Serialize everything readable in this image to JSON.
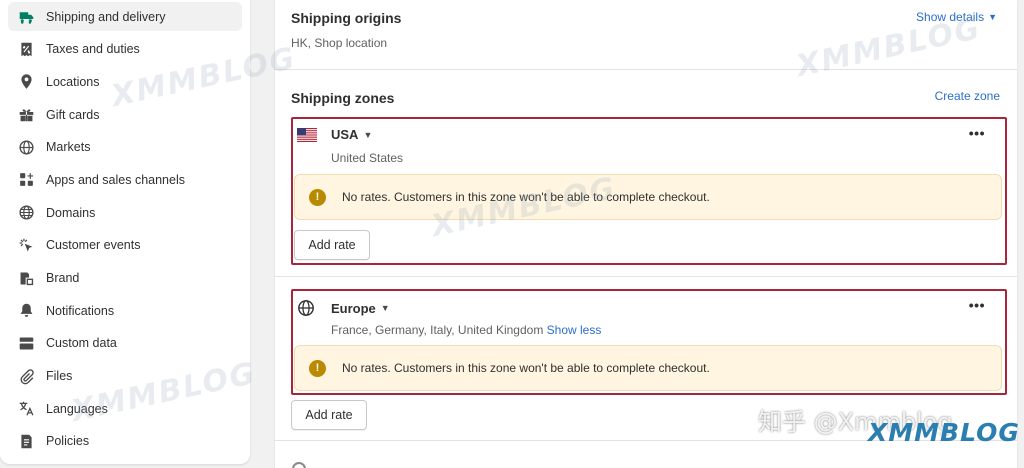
{
  "sidebar": {
    "items": [
      {
        "label": "Shipping and delivery",
        "icon": "truck-icon",
        "active": true
      },
      {
        "label": "Taxes and duties",
        "icon": "receipt-percent-icon",
        "active": false
      },
      {
        "label": "Locations",
        "icon": "location-pin-icon",
        "active": false
      },
      {
        "label": "Gift cards",
        "icon": "gift-icon",
        "active": false
      },
      {
        "label": "Markets",
        "icon": "globe-icon",
        "active": false
      },
      {
        "label": "Apps and sales channels",
        "icon": "apps-icon",
        "active": false
      },
      {
        "label": "Domains",
        "icon": "globe-icon",
        "active": false
      },
      {
        "label": "Customer events",
        "icon": "cursor-click-icon",
        "active": false
      },
      {
        "label": "Brand",
        "icon": "brand-icon",
        "active": false
      },
      {
        "label": "Notifications",
        "icon": "bell-icon",
        "active": false
      },
      {
        "label": "Custom data",
        "icon": "database-icon",
        "active": false
      },
      {
        "label": "Files",
        "icon": "paperclip-icon",
        "active": false
      },
      {
        "label": "Languages",
        "icon": "translate-icon",
        "active": false
      },
      {
        "label": "Policies",
        "icon": "document-icon",
        "active": false
      }
    ]
  },
  "origins": {
    "title": "Shipping origins",
    "subtitle": "HK, Shop location",
    "show_details": "Show details"
  },
  "zones": {
    "title": "Shipping zones",
    "create_zone": "Create zone",
    "items": [
      {
        "name": "USA",
        "countries": "United States",
        "banner": "No rates. Customers in this zone won't be able to complete checkout.",
        "add_rate": "Add rate"
      },
      {
        "name": "Europe",
        "countries": "France, Germany, Italy, United Kingdom",
        "show_less": "Show less",
        "banner": "No rates. Customers in this zone won't be able to complete checkout.",
        "add_rate": "Add rate"
      }
    ]
  },
  "watermarks": {
    "xmmblog": "XMMBLOG",
    "zhihu": "知乎 @Xmmblog"
  },
  "colors": {
    "accent_green": "#008060",
    "link_blue": "#2c6ecb",
    "highlight_border": "#a8263a",
    "warning_bg": "#fff5e1",
    "warning_icon": "#b98900"
  }
}
